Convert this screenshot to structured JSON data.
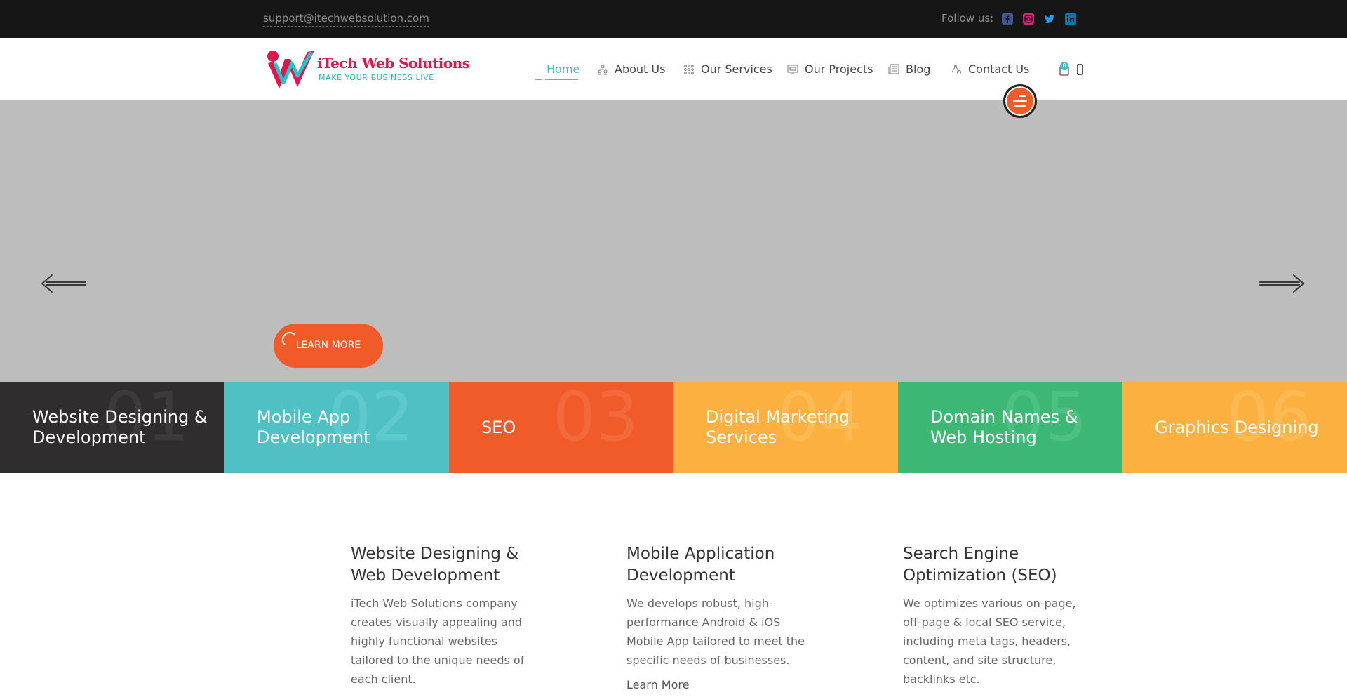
{
  "topbar": {
    "email": "support@itechwebsolution.com",
    "follow_label": "Follow us:",
    "social": [
      "facebook-icon",
      "instagram-icon",
      "twitter-icon",
      "linkedin-icon"
    ]
  },
  "logo": {
    "brand": "iTech Web Solutions",
    "tagline": "MAKE YOUR BUSINESS LIVE"
  },
  "nav": {
    "items": [
      {
        "label": "Home",
        "icon": "home-icon",
        "active": true
      },
      {
        "label": "About Us",
        "icon": "people-icon"
      },
      {
        "label": "Our Services",
        "icon": "grid-icon"
      },
      {
        "label": "Our Projects",
        "icon": "monitor-icon"
      },
      {
        "label": "Blog",
        "icon": "newspaper-icon"
      },
      {
        "label": "Contact Us",
        "icon": "contact-icon"
      }
    ],
    "cart_count": "0"
  },
  "hero": {
    "button_label": "LEARN MORE"
  },
  "services_strip": [
    {
      "label": "Website Designing & Development",
      "num": "01",
      "bg": "#302d2f",
      "num_color": "#3d3a3c"
    },
    {
      "label": "Mobile App Development",
      "num": "02",
      "bg": "#4fc1c4",
      "num_color": "#5fcacd"
    },
    {
      "label": "SEO",
      "num": "03",
      "bg": "#f15a29",
      "num_color": "#f26a3c"
    },
    {
      "label": "Digital Marketing Services",
      "num": "04",
      "bg": "#fbb040",
      "num_color": "#fcba52"
    },
    {
      "label": "Domain Names & Web Hosting",
      "num": "05",
      "bg": "#3db874",
      "num_color": "#4dc182"
    },
    {
      "label": "Graphics Designing",
      "num": "06",
      "bg": "#fbb040",
      "num_color": "#fcba52"
    }
  ],
  "columns": [
    {
      "title": "Website Designing & Web Development",
      "text": "iTech Web Solutions company creates visually appealing and highly functional websites tailored to the unique needs of each client."
    },
    {
      "title": "Mobile Application Development",
      "text": "We develops robust, high-performance Android & iOS Mobile App tailored to meet the specific needs of businesses.",
      "more": "Learn More"
    },
    {
      "title": "Search Engine Optimization (SEO)",
      "text": "We optimizes various on-page, off-page & local SEO service, including meta tags, headers, content, and site structure, backlinks etc."
    }
  ],
  "colors": {
    "accent": "#3fbfc1",
    "orange": "#f15a29",
    "topbar": "#161616",
    "hero": "#bdbdbd"
  }
}
